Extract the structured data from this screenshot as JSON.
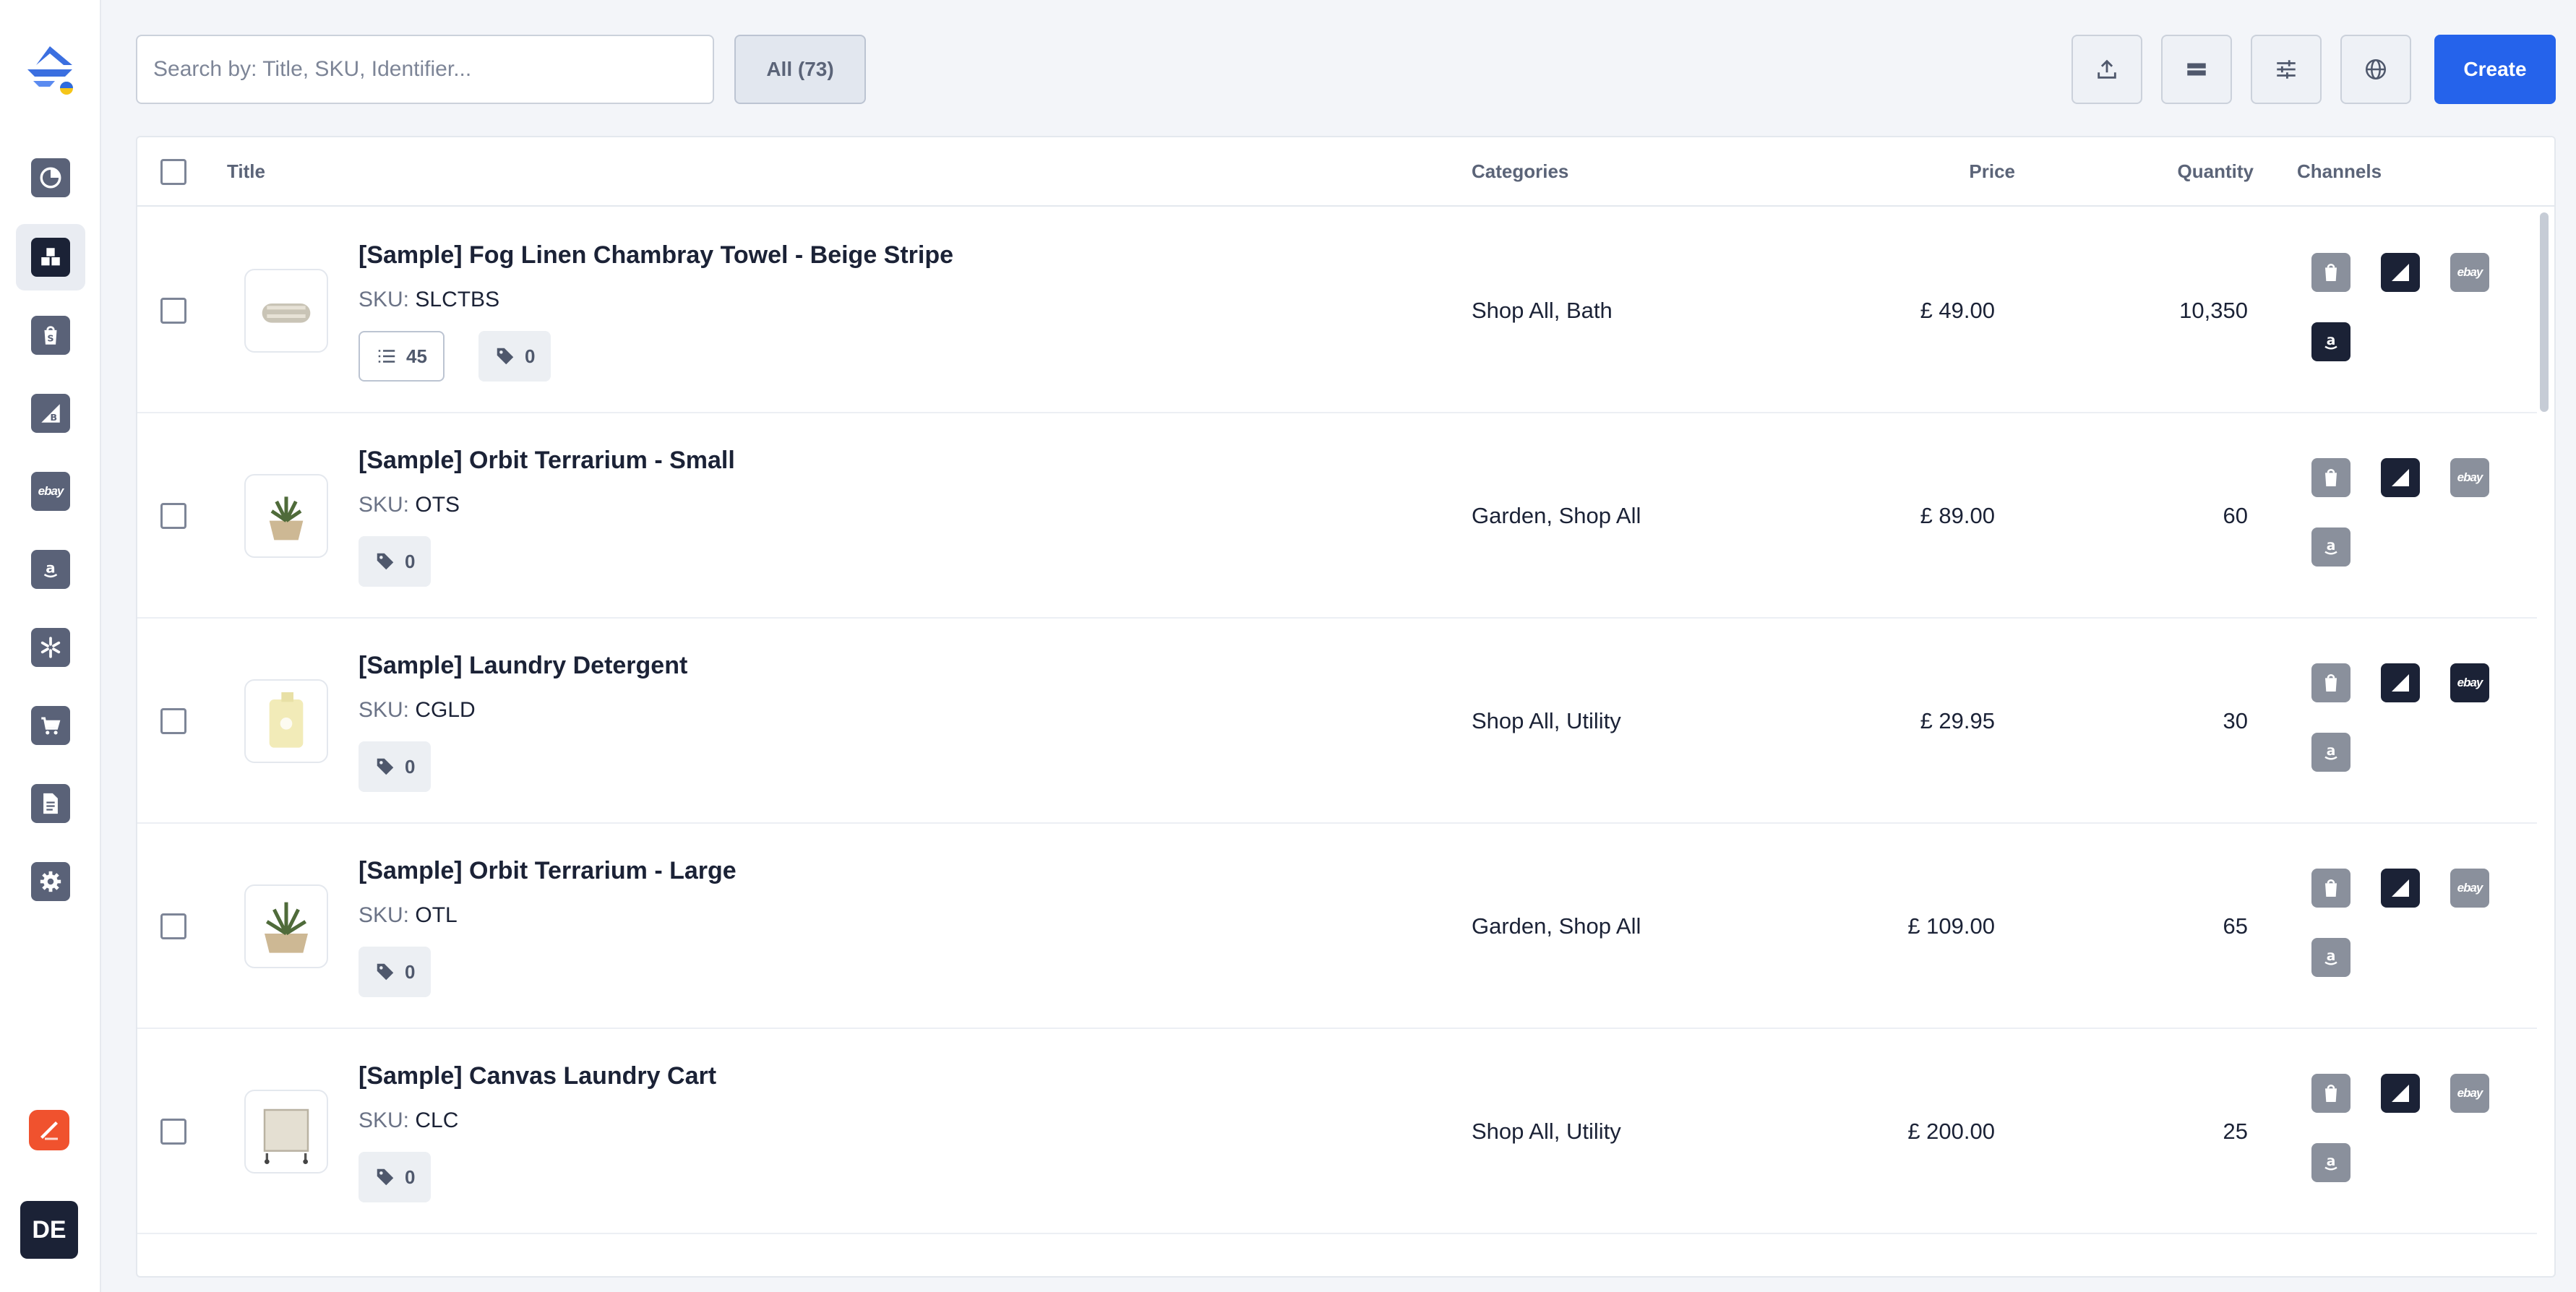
{
  "sidebar": {
    "items": [
      {
        "name": "sidebar-item-dashboard",
        "icon": "pie-chart-icon",
        "active": false
      },
      {
        "name": "sidebar-item-products",
        "icon": "boxes-icon",
        "active": true
      },
      {
        "name": "sidebar-item-shopify",
        "icon": "shopify-icon",
        "active": false
      },
      {
        "name": "sidebar-item-bigcommerce",
        "icon": "bigcommerce-icon",
        "active": false
      },
      {
        "name": "sidebar-item-ebay",
        "icon": "ebay-icon",
        "label": "ebay",
        "active": false
      },
      {
        "name": "sidebar-item-amazon",
        "icon": "amazon-icon",
        "active": false
      },
      {
        "name": "sidebar-item-walmart",
        "icon": "walmart-spark-icon",
        "active": false
      },
      {
        "name": "sidebar-item-cart",
        "icon": "cart-icon",
        "active": false
      },
      {
        "name": "sidebar-item-documents",
        "icon": "document-icon",
        "active": false
      },
      {
        "name": "sidebar-item-settings",
        "icon": "gear-icon",
        "active": false
      }
    ],
    "avatar_initials": "DE"
  },
  "toolbar": {
    "search_placeholder": "Search by: Title, SKU, Identifier...",
    "filter_all_label": "All (73)",
    "create_label": "Create",
    "buttons": [
      "upload-icon",
      "rows-icon",
      "sliders-icon",
      "globe-icon"
    ]
  },
  "table": {
    "columns": {
      "title": "Title",
      "categories": "Categories",
      "price": "Price",
      "quantity": "Quantity",
      "channels": "Channels"
    },
    "rows": [
      {
        "title": "[Sample] Fog Linen Chambray Towel - Beige Stripe",
        "sku_label": "SKU:",
        "sku": "SLCTBS",
        "variants": "45",
        "tags": "0",
        "categories": "Shop All, Bath",
        "price": "£ 49.00",
        "quantity": "10,350",
        "channels": {
          "shopify": "grey",
          "bigcommerce": "dark",
          "ebay": "grey",
          "amazon": "dark"
        }
      },
      {
        "title": "[Sample] Orbit Terrarium - Small",
        "sku_label": "SKU:",
        "sku": "OTS",
        "tags": "0",
        "categories": "Garden, Shop All",
        "price": "£ 89.00",
        "quantity": "60",
        "channels": {
          "shopify": "grey",
          "bigcommerce": "dark",
          "ebay": "grey",
          "amazon": "grey"
        }
      },
      {
        "title": "[Sample] Laundry Detergent",
        "sku_label": "SKU:",
        "sku": "CGLD",
        "tags": "0",
        "categories": "Shop All, Utility",
        "price": "£ 29.95",
        "quantity": "30",
        "channels": {
          "shopify": "grey",
          "bigcommerce": "dark",
          "ebay": "dark",
          "amazon": "grey"
        }
      },
      {
        "title": "[Sample] Orbit Terrarium - Large",
        "sku_label": "SKU:",
        "sku": "OTL",
        "tags": "0",
        "categories": "Garden, Shop All",
        "price": "£ 109.00",
        "quantity": "65",
        "channels": {
          "shopify": "grey",
          "bigcommerce": "dark",
          "ebay": "grey",
          "amazon": "grey"
        }
      },
      {
        "title": "[Sample] Canvas Laundry Cart",
        "sku_label": "SKU:",
        "sku": "CLC",
        "tags": "0",
        "categories": "Shop All, Utility",
        "price": "£ 200.00",
        "quantity": "25",
        "channels": {
          "shopify": "grey",
          "bigcommerce": "dark",
          "ebay": "grey",
          "amazon": "grey"
        }
      }
    ]
  },
  "colors": {
    "accent": "#2563eb",
    "sidebar_icon": "#5a6278",
    "channel_active": "#1b2236",
    "channel_inactive": "#8a909c"
  }
}
